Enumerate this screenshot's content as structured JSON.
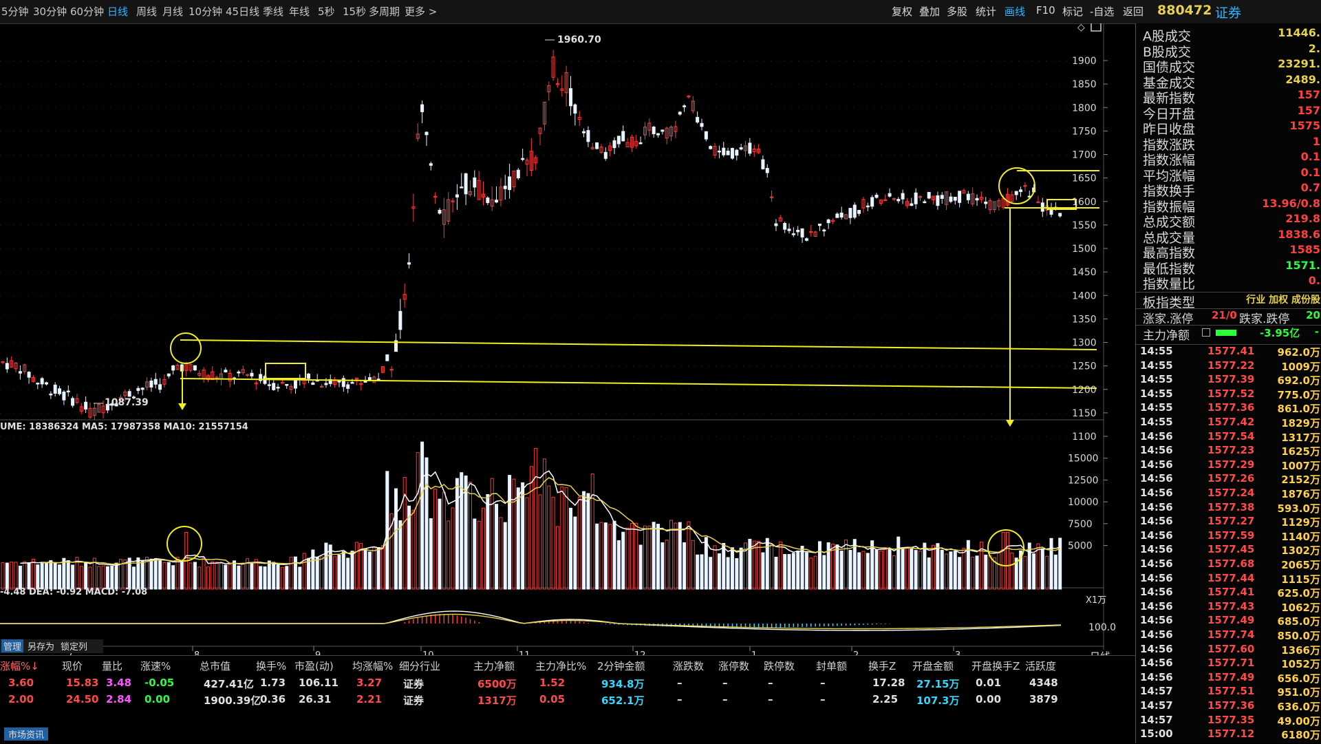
{
  "toolbar": {
    "periods": [
      "5分钟",
      "30分钟",
      "60分钟",
      "日线",
      "周线",
      "月线",
      "10分钟",
      "45日线",
      "季线",
      "年线",
      "5秒",
      "15秒",
      "多周期",
      "更多 >"
    ],
    "active_period": "日线",
    "tools": [
      "复权",
      "叠加",
      "多股",
      "统计",
      "画线",
      "F10",
      "标记",
      "-自选",
      "返回"
    ],
    "active_tool": "画线"
  },
  "security": {
    "code": "880472",
    "name": "证券"
  },
  "chart": {
    "price_axis": [
      "1900",
      "1850",
      "1800",
      "1750",
      "1700",
      "1650",
      "1600",
      "1550",
      "1500",
      "1450",
      "1400",
      "1350",
      "1300",
      "1250",
      "1200",
      "1150",
      "1100"
    ],
    "high_label": "1960.70",
    "low_label": "1087.39",
    "volume_header": "UME: 18386324  MA5: 17987358  MA10: 21557154",
    "volume_axis": [
      "15000",
      "12500",
      "10000",
      "7500",
      "5000"
    ],
    "volume_unit": "X1万",
    "macd_header": "-4.48  DEA: -0.92  MACD: -7.08",
    "macd_axis": "100.0",
    "date_labels": [
      "7",
      "8",
      "9",
      "10",
      "11",
      "12",
      "1",
      "2",
      "3"
    ],
    "period_label": "日线"
  },
  "right_panel": {
    "stats": [
      {
        "k": "A股成交",
        "v": "11446."
      },
      {
        "k": "B股成交",
        "v": "2."
      },
      {
        "k": "国债成交",
        "v": "23291."
      },
      {
        "k": "基金成交",
        "v": "2489."
      },
      {
        "k": "最新指数",
        "v": "157"
      },
      {
        "k": "今日开盘",
        "v": "157"
      },
      {
        "k": "昨日收盘",
        "v": "1575"
      },
      {
        "k": "指数涨跌",
        "v": "1"
      },
      {
        "k": "指数涨幅",
        "v": "0.1"
      },
      {
        "k": "平均涨幅",
        "v": "0.1"
      },
      {
        "k": "指数换手",
        "v": "0.7"
      },
      {
        "k": "指数振幅",
        "v": "13.96/0.8"
      },
      {
        "k": "总成交额",
        "v": "219.8"
      },
      {
        "k": "总成交量",
        "v": "1838.6"
      },
      {
        "k": "最高指数",
        "v": "1585"
      },
      {
        "k": "最低指数",
        "v": "1571."
      },
      {
        "k": "指数量比",
        "v": "0."
      }
    ],
    "sector_type_label": "板指类型",
    "sector_type_value": "行业 加权 成份股",
    "limit_up_label": "涨家.涨停",
    "limit_up_value": "21/0",
    "limit_down_label": "跌家.跌停",
    "limit_down_value": "20",
    "main_net_label": "主力净额",
    "main_net_value": "-3.95亿",
    "main_net_value2": "-",
    "ticks": [
      {
        "t": "14:55",
        "p": "1577.41",
        "v": "962.0万"
      },
      {
        "t": "14:55",
        "p": "1577.22",
        "v": "1009万"
      },
      {
        "t": "14:55",
        "p": "1577.39",
        "v": "692.0万"
      },
      {
        "t": "14:55",
        "p": "1577.52",
        "v": "775.0万"
      },
      {
        "t": "14:55",
        "p": "1577.36",
        "v": "861.0万"
      },
      {
        "t": "14:55",
        "p": "1577.42",
        "v": "1829万"
      },
      {
        "t": "14:56",
        "p": "1577.54",
        "v": "1317万"
      },
      {
        "t": "14:56",
        "p": "1577.23",
        "v": "1625万"
      },
      {
        "t": "14:56",
        "p": "1577.29",
        "v": "1007万"
      },
      {
        "t": "14:56",
        "p": "1577.26",
        "v": "2152万"
      },
      {
        "t": "14:56",
        "p": "1577.24",
        "v": "1876万"
      },
      {
        "t": "14:56",
        "p": "1577.38",
        "v": "593.0万"
      },
      {
        "t": "14:56",
        "p": "1577.27",
        "v": "1129万"
      },
      {
        "t": "14:56",
        "p": "1577.59",
        "v": "1140万"
      },
      {
        "t": "14:56",
        "p": "1577.45",
        "v": "1302万"
      },
      {
        "t": "14:56",
        "p": "1577.68",
        "v": "2065万"
      },
      {
        "t": "14:56",
        "p": "1577.44",
        "v": "1115万"
      },
      {
        "t": "14:56",
        "p": "1577.41",
        "v": "625.0万"
      },
      {
        "t": "14:56",
        "p": "1577.43",
        "v": "1062万"
      },
      {
        "t": "14:56",
        "p": "1577.49",
        "v": "685.0万"
      },
      {
        "t": "14:56",
        "p": "1577.74",
        "v": "850.0万"
      },
      {
        "t": "14:56",
        "p": "1577.60",
        "v": "1366万"
      },
      {
        "t": "14:56",
        "p": "1577.71",
        "v": "1052万"
      },
      {
        "t": "14:56",
        "p": "1577.49",
        "v": "656.0万"
      },
      {
        "t": "14:57",
        "p": "1577.51",
        "v": "951.0万"
      },
      {
        "t": "14:57",
        "p": "1577.36",
        "v": "636.0万"
      },
      {
        "t": "14:57",
        "p": "1577.35",
        "v": "49.00万"
      },
      {
        "t": "15:00",
        "p": "1577.12",
        "v": "6180万"
      }
    ]
  },
  "table": {
    "tabs": [
      "管理",
      "另存为",
      "锁定列"
    ],
    "headers": [
      "涨幅%↓",
      "现价",
      "量比",
      "涨速%",
      "总市值",
      "换手%",
      "市盈(动)",
      "均涨幅%",
      "细分行业",
      "主力净额",
      "主力净比%",
      "2分钟金额",
      "涨跌数",
      "涨停数",
      "跌停数",
      "封单额",
      "换手Z",
      "开盘金额",
      "开盘换手Z",
      "活跃度"
    ],
    "rows": [
      [
        "3.60",
        "15.83",
        "3.48",
        "-0.05",
        "427.41亿",
        "1.73",
        "106.11",
        "3.27",
        "证券",
        "6500万",
        "1.52",
        "934.8万",
        "–",
        "–",
        "–",
        "–",
        "17.28",
        "27.15万",
        "0.01",
        "4348"
      ],
      [
        "2.00",
        "24.50",
        "2.84",
        "0.00",
        "1900.39亿",
        "0.36",
        "26.31",
        "2.21",
        "证券",
        "1317万",
        "0.05",
        "652.1万",
        "–",
        "–",
        "–",
        "–",
        "2.25",
        "107.3万",
        "0.00",
        "3879"
      ]
    ],
    "footer_tab": "市场资讯"
  },
  "colors": {
    "up": "#ff3b3b",
    "down": "#e8f4ff",
    "annotation": "#f2ee20",
    "ma_white": "#ffffff",
    "ma_yellow": "#e8d24a",
    "axis": "#9a9a9a"
  }
}
